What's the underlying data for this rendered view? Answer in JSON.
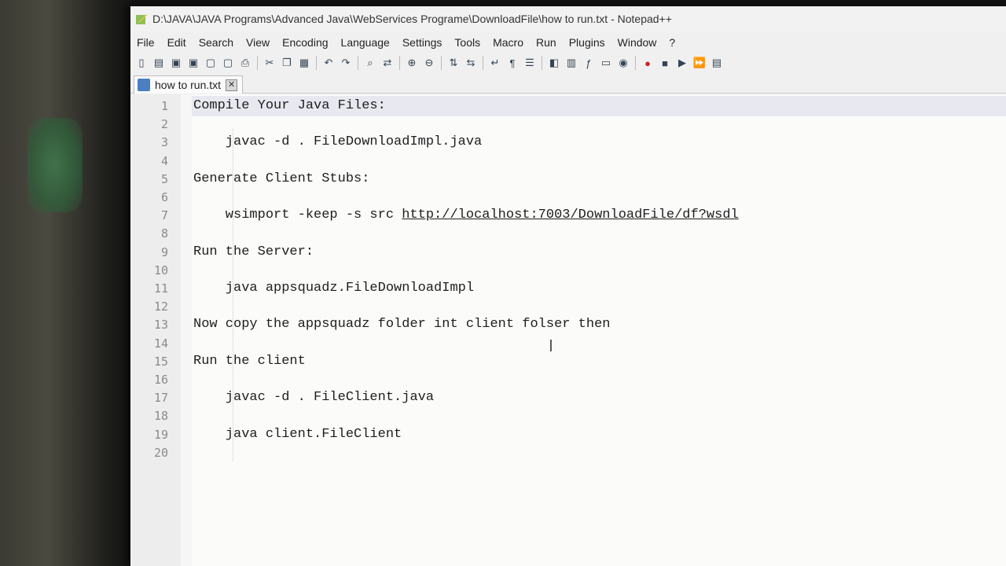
{
  "window": {
    "title": "D:\\JAVA\\JAVA Programs\\Advanced Java\\WebServices Programe\\DownloadFile\\how to run.txt - Notepad++"
  },
  "menu": [
    "File",
    "Edit",
    "Search",
    "View",
    "Encoding",
    "Language",
    "Settings",
    "Tools",
    "Macro",
    "Run",
    "Plugins",
    "Window",
    "?"
  ],
  "toolbar": {
    "icons": [
      "new-file-icon",
      "open-file-icon",
      "save-icon",
      "save-all-icon",
      "close-icon",
      "close-all-icon",
      "print-icon",
      "cut-icon",
      "copy-icon",
      "paste-icon",
      "undo-icon",
      "redo-icon",
      "find-icon",
      "replace-icon",
      "zoom-in-icon",
      "zoom-out-icon",
      "sync-vertical-icon",
      "sync-horizontal-icon",
      "word-wrap-icon",
      "show-all-chars-icon",
      "indent-guide-icon",
      "user-language-icon",
      "document-map-icon",
      "function-list-icon",
      "folder-as-workspace-icon",
      "monitoring-icon",
      "record-macro-icon",
      "stop-macro-icon",
      "play-macro-icon",
      "play-multiple-icon",
      "save-macro-icon"
    ]
  },
  "tab": {
    "label": "how to run.txt",
    "close": "✕"
  },
  "editor": {
    "lines": [
      {
        "num": "1",
        "text": "Compile Your Java Files:"
      },
      {
        "num": "2",
        "text": ""
      },
      {
        "num": "3",
        "text": "    javac -d . FileDownloadImpl.java"
      },
      {
        "num": "4",
        "text": ""
      },
      {
        "num": "5",
        "text": "Generate Client Stubs:"
      },
      {
        "num": "6",
        "text": ""
      },
      {
        "num": "7",
        "text": "    wsimport -keep -s src ",
        "url": "http://localhost:7003/DownloadFile/df?wsdl"
      },
      {
        "num": "8",
        "text": ""
      },
      {
        "num": "9",
        "text": "Run the Server:"
      },
      {
        "num": "10",
        "text": ""
      },
      {
        "num": "11",
        "text": "    java appsquadz.FileDownloadImpl"
      },
      {
        "num": "12",
        "text": ""
      },
      {
        "num": "13",
        "text": "Now copy the appsquadz folder int client folser then"
      },
      {
        "num": "14",
        "text": ""
      },
      {
        "num": "15",
        "text": "Run the client"
      },
      {
        "num": "16",
        "text": ""
      },
      {
        "num": "17",
        "text": "    javac -d . FileClient.java"
      },
      {
        "num": "18",
        "text": ""
      },
      {
        "num": "19",
        "text": "    java client.FileClient"
      },
      {
        "num": "20",
        "text": ""
      }
    ]
  }
}
